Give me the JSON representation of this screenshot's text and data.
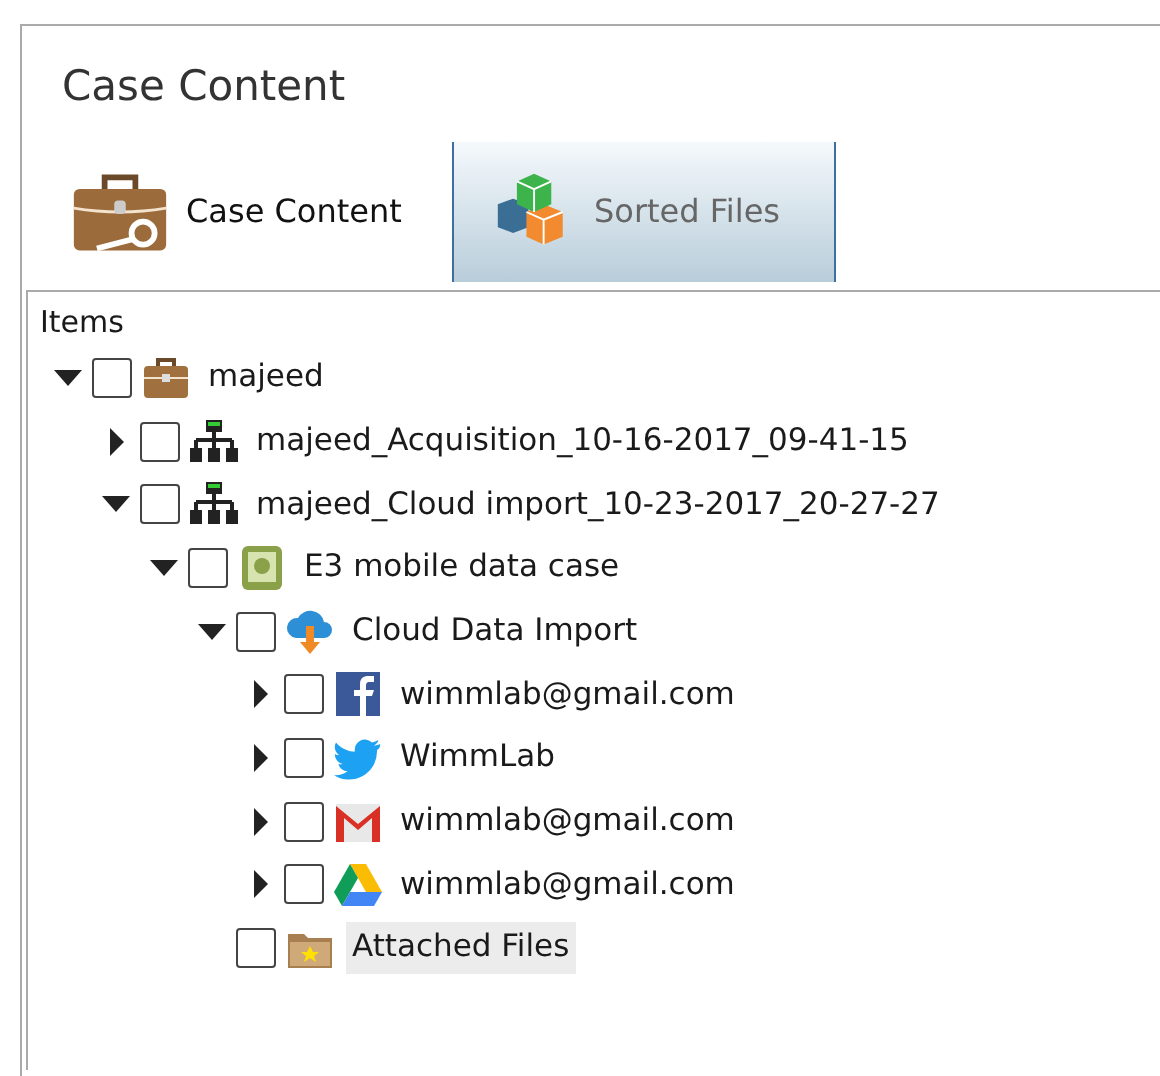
{
  "panel": {
    "title": "Case Content"
  },
  "tabs": [
    {
      "label": "Case Content",
      "kind": "case",
      "selected": true
    },
    {
      "label": "Sorted Files",
      "kind": "cubes",
      "selected": false
    }
  ],
  "tree": {
    "header": "Items",
    "items": [
      {
        "label": "majeed",
        "kind": "case",
        "expanded": true,
        "checked": false,
        "selected": false,
        "children": [
          {
            "label": "majeed_Acquisition_10-16-2017_09-41-15",
            "kind": "network",
            "expanded": false,
            "checked": false,
            "selected": false
          },
          {
            "label": "majeed_Cloud import_10-23-2017_20-27-27",
            "kind": "network",
            "expanded": true,
            "checked": false,
            "selected": false,
            "children": [
              {
                "label": "E3 mobile data case",
                "kind": "mobile",
                "expanded": true,
                "checked": false,
                "selected": false,
                "children": [
                  {
                    "label": "Cloud Data Import",
                    "kind": "cloud",
                    "expanded": true,
                    "checked": false,
                    "selected": false,
                    "children": [
                      {
                        "label": "wimmlab@gmail.com",
                        "kind": "facebook",
                        "expanded": false,
                        "checked": false,
                        "selected": false
                      },
                      {
                        "label": "WimmLab",
                        "kind": "twitter",
                        "expanded": false,
                        "checked": false,
                        "selected": false
                      },
                      {
                        "label": "wimmlab@gmail.com",
                        "kind": "gmail",
                        "expanded": false,
                        "checked": false,
                        "selected": false
                      },
                      {
                        "label": "wimmlab@gmail.com",
                        "kind": "drive",
                        "expanded": false,
                        "checked": false,
                        "selected": false
                      }
                    ]
                  },
                  {
                    "label": "Attached Files",
                    "kind": "folder",
                    "checked": false,
                    "selected": true
                  }
                ]
              }
            ]
          }
        ]
      }
    ]
  }
}
